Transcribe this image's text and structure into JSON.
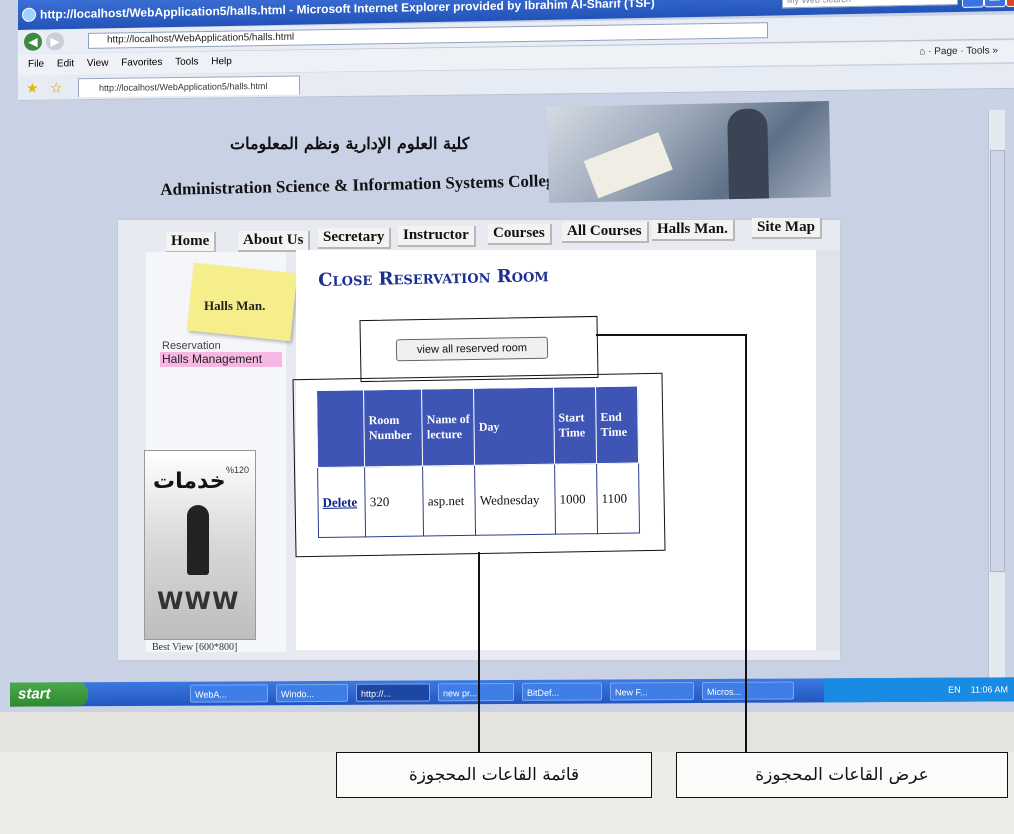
{
  "window": {
    "title": "http://localhost/WebApplication5/halls.html - Microsoft Internet Explorer provided by Ibrahim Al-Sharif (TSF)",
    "search_placeholder": "My Web Search"
  },
  "address": {
    "url": "http://localhost/WebApplication5/halls.html"
  },
  "menubar": {
    "items": [
      "File",
      "Edit",
      "View",
      "Favorites",
      "Tools",
      "Help"
    ],
    "page_label": "Page",
    "tools_label": "Tools"
  },
  "tab": {
    "label": "http://localhost/WebApplication5/halls.html"
  },
  "site": {
    "college_ar": "كلية العلوم الإدارية ونظم المعلومات",
    "college_en": "Administration Science & Information Systems College",
    "nav": [
      "Home",
      "About Us",
      "Secretary",
      "Instructor",
      "Courses",
      "All Courses",
      "Halls Man.",
      "Site Map"
    ]
  },
  "sidebar": {
    "sticky_label": "Halls Man.",
    "reservation_label": "Reservation",
    "halls_management_label": "Halls Management",
    "ad_arabic": "خدمات",
    "ad_percent": "%120",
    "ad_www": "WWW",
    "ad_caption": "Best View [600*800]"
  },
  "main": {
    "title": "Close Reservation Room",
    "view_button": "view all reserved room",
    "table": {
      "headers": [
        "",
        "Room Number",
        "Name of lecture",
        "Day",
        "Start Time",
        "End Time"
      ],
      "rows": [
        {
          "action": "Delete",
          "room": "320",
          "lecture": "asp.net",
          "day": "Wednesday",
          "start": "1000",
          "end": "1100"
        }
      ]
    }
  },
  "taskbar": {
    "start": "start",
    "tasks": [
      "WebA...",
      "Windo...",
      "http://...",
      "new pr...",
      "BitDef...",
      "New F...",
      "Micros..."
    ],
    "tray_lang": "EN",
    "clock": "11:06 AM"
  },
  "annotations": {
    "view_reserved": "عرض القاعات المحجوزة",
    "reserved_list": "قائمة القاعات المحجوزة"
  },
  "colors": {
    "table_header": "#3f55b5",
    "title_text": "#1d2f8f",
    "halls_highlight": "#f6b7e2",
    "sticky": "#f6ee8a"
  }
}
